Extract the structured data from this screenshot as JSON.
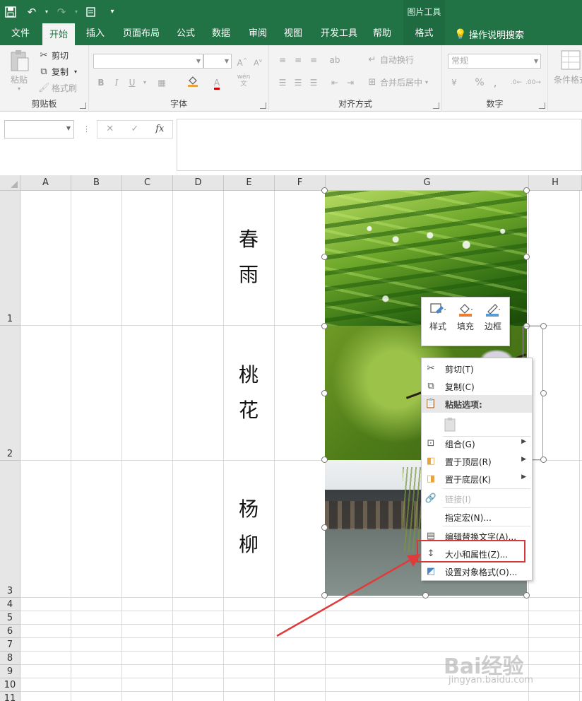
{
  "ribbon_tabs": [
    "文件",
    "开始",
    "插入",
    "页面布局",
    "公式",
    "数据",
    "审阅",
    "视图",
    "开发工具",
    "帮助",
    "格式"
  ],
  "active_tab": "开始",
  "context_tool_title": "图片工具",
  "tell_me": "操作说明搜索",
  "clipboard": {
    "paste": "粘贴",
    "cut": "剪切",
    "copy": "复制",
    "format_painter": "格式刷",
    "label": "剪贴板"
  },
  "font": {
    "label": "字体",
    "grow": "A",
    "shrink": "A",
    "bold": "B",
    "italic": "I",
    "underline": "U",
    "font_color": "A",
    "phonetic": "wén"
  },
  "alignment": {
    "label": "对齐方式",
    "wrap": "自动换行",
    "merge": "合并后居中"
  },
  "number": {
    "label": "数字",
    "format": "常规",
    "percent": "%",
    "comma": ","
  },
  "styles": {
    "conditional": "条件格式"
  },
  "formula_bar": {
    "cancel": "✕",
    "enter": "✓",
    "fx": "fx"
  },
  "columns": [
    "A",
    "B",
    "C",
    "D",
    "E",
    "F",
    "G",
    "H"
  ],
  "rows": [
    "1",
    "2",
    "3",
    "4",
    "5",
    "6",
    "7",
    "8",
    "9",
    "10",
    "11"
  ],
  "poems": [
    {
      "line1": "春",
      "line2": "雨"
    },
    {
      "line1": "桃",
      "line2": "花"
    },
    {
      "line1": "杨",
      "line2": "柳"
    }
  ],
  "mini_toolbar": {
    "style": "样式",
    "fill": "填充",
    "border": "边框"
  },
  "context_menu": {
    "cut": "剪切(T)",
    "copy": "复制(C)",
    "paste_options": "粘贴选项:",
    "group": "组合(G)",
    "bring_front": "置于顶层(R)",
    "send_back": "置于底层(K)",
    "link": "链接(I)",
    "assign_macro": "指定宏(N)...",
    "edit_alt_text": "编辑替换文字(A)...",
    "size_properties": "大小和属性(Z)...",
    "format_object": "设置对象格式(O)..."
  },
  "watermark": {
    "brand": "Bai经验",
    "url": "jingyan.baidu.com"
  },
  "colors": {
    "excel_green": "#217346",
    "highlight_red": "#d33b3b",
    "annotation_arrow": "#e03a3a"
  }
}
